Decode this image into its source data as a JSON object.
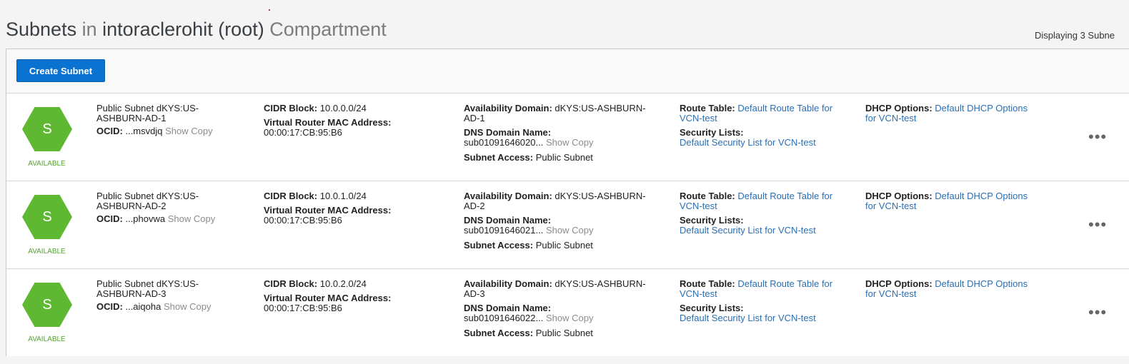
{
  "header": {
    "title_part1": "Subnets",
    "title_in": "in",
    "title_compartment_name": "intoraclerohit (root)",
    "title_part2": "Compartment",
    "displaying": "Displaying 3 Subne"
  },
  "toolbar": {
    "create_label": "Create Subnet"
  },
  "labels": {
    "ocid": "OCID:",
    "show": "Show",
    "copy": "Copy",
    "cidr": "CIDR Block:",
    "mac": "Virtual Router MAC Address:",
    "ad": "Availability Domain:",
    "dns": "DNS Domain Name:",
    "access": "Subnet Access:",
    "route": "Route Table:",
    "seclists": "Security Lists:",
    "dhcp": "DHCP Options:",
    "more": "•••"
  },
  "colors": {
    "available": "#55a52f",
    "accent": "#0a72d1",
    "link": "#2a6fb5"
  },
  "subnets": [
    {
      "icon_letter": "S",
      "state": "AVAILABLE",
      "name_line1": "Public Subnet dKYS:US-",
      "name_line2": "ASHBURN-AD-1",
      "ocid": "...msvdjq",
      "cidr": "10.0.0.0/24",
      "mac": "00:00:17:CB:95:B6",
      "ad_line1": "dKYS:US-ASHBURN-",
      "ad_line2": "AD-1",
      "dns": "sub01091646020...",
      "access": "Public Subnet",
      "route_line1": "Default Route Table for",
      "route_line2": "VCN-test",
      "seclist": "Default Security List for VCN-test",
      "dhcp_line1": "Default DHCP Options",
      "dhcp_line2": "for VCN-test"
    },
    {
      "icon_letter": "S",
      "state": "AVAILABLE",
      "name_line1": "Public Subnet dKYS:US-",
      "name_line2": "ASHBURN-AD-2",
      "ocid": "...phovwa",
      "cidr": "10.0.1.0/24",
      "mac": "00:00:17:CB:95:B6",
      "ad_line1": "dKYS:US-ASHBURN-",
      "ad_line2": "AD-2",
      "dns": "sub01091646021...",
      "access": "Public Subnet",
      "route_line1": "Default Route Table for",
      "route_line2": "VCN-test",
      "seclist": "Default Security List for VCN-test",
      "dhcp_line1": "Default DHCP Options",
      "dhcp_line2": "for VCN-test"
    },
    {
      "icon_letter": "S",
      "state": "AVAILABLE",
      "name_line1": "Public Subnet dKYS:US-",
      "name_line2": "ASHBURN-AD-3",
      "ocid": "...aiqoha",
      "cidr": "10.0.2.0/24",
      "mac": "00:00:17:CB:95:B6",
      "ad_line1": "dKYS:US-ASHBURN-",
      "ad_line2": "AD-3",
      "dns": "sub01091646022...",
      "access": "Public Subnet",
      "route_line1": "Default Route Table for",
      "route_line2": "VCN-test",
      "seclist": "Default Security List for VCN-test",
      "dhcp_line1": "Default DHCP Options",
      "dhcp_line2": "for VCN-test"
    }
  ]
}
